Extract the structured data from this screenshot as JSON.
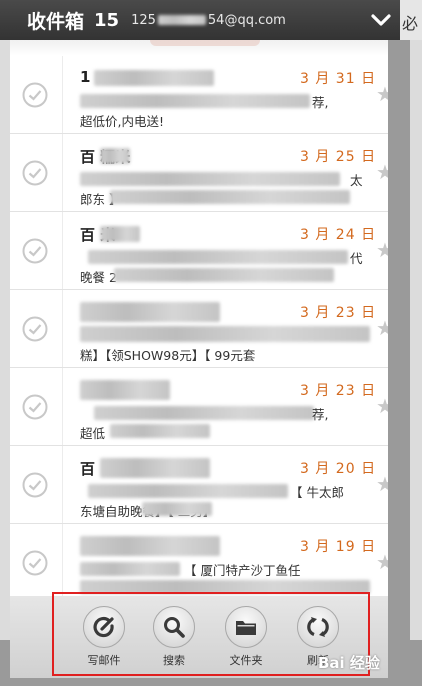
{
  "header": {
    "title": "收件箱",
    "count": "15",
    "email_prefix": "125",
    "email_suffix": "54@qq.com"
  },
  "background_glyph": "必",
  "messages": [
    {
      "sender": "1",
      "date": "3 月 31 日",
      "line2_right": "荐,",
      "line3": "超低价,内电送!"
    },
    {
      "sender": "百 糯米",
      "date": "3 月 25 日",
      "line2_right": "太",
      "line3": "郎东 】"
    },
    {
      "sender": "百 米",
      "date": "3 月 24 日",
      "line2_right": "代",
      "line3": "晚餐 2"
    },
    {
      "sender": "",
      "date": "3 月 23 日",
      "line2_right": "",
      "line3": "糕】【领SHOW98元】【 99元套"
    },
    {
      "sender": "",
      "date": "3 月 23 日",
      "line2_right": "荐,",
      "line3": "超低"
    },
    {
      "sender": "百",
      "date": "3 月 20 日",
      "line2_right": "【 牛太郎",
      "line3": "东塘自助晚餐】【 二另】"
    },
    {
      "sender": "",
      "date": "3 月 19 日",
      "line2_right": "【 厦门特产沙丁鱼任",
      "line3": ""
    }
  ],
  "toolbar": {
    "compose_label": "写邮件",
    "search_label": "搜索",
    "folder_label": "文件夹",
    "refresh_label": "刷新"
  },
  "watermark": "Bai 经验",
  "colors": {
    "date": "#d3691e",
    "header": "#3a3a3a",
    "highlight_frame": "#e02020"
  }
}
